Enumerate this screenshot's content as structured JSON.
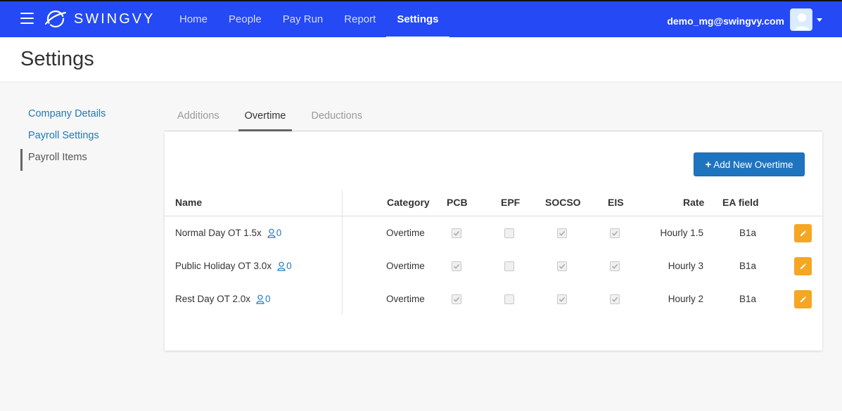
{
  "app": {
    "brand": "SWINGVY"
  },
  "nav": {
    "items": [
      "Home",
      "People",
      "Pay Run",
      "Report",
      "Settings"
    ]
  },
  "user": {
    "email": "demo_mg@swingvy.com"
  },
  "page": {
    "title": "Settings"
  },
  "sidebar": {
    "items": [
      {
        "label": "Company Details"
      },
      {
        "label": "Payroll Settings"
      },
      {
        "label": "Payroll Items"
      }
    ]
  },
  "tabs": [
    "Additions",
    "Overtime",
    "Deductions"
  ],
  "actions": {
    "add_label": "Add New Overtime",
    "add_icon": "plus-icon"
  },
  "table": {
    "headers": {
      "name": "Name",
      "category": "Category",
      "pcb": "PCB",
      "epf": "EPF",
      "socso": "SOCSO",
      "eis": "EIS",
      "rate": "Rate",
      "ea_field": "EA field"
    },
    "rows": [
      {
        "name": "Normal Day OT 1.5x",
        "employees": "0",
        "category": "Overtime",
        "pcb": true,
        "epf": false,
        "socso": true,
        "eis": true,
        "rate": "Hourly 1.5",
        "ea_field": "B1a"
      },
      {
        "name": "Public Holiday OT 3.0x",
        "employees": "0",
        "category": "Overtime",
        "pcb": true,
        "epf": false,
        "socso": true,
        "eis": true,
        "rate": "Hourly 3",
        "ea_field": "B1a"
      },
      {
        "name": "Rest Day OT 2.0x",
        "employees": "0",
        "category": "Overtime",
        "pcb": true,
        "epf": false,
        "socso": true,
        "eis": true,
        "rate": "Hourly 2",
        "ea_field": "B1a"
      }
    ]
  },
  "colors": {
    "nav_bg": "#2449f5",
    "link": "#1f7ab8",
    "primary_button": "#1f74c0",
    "edit_button": "#f5a623"
  }
}
